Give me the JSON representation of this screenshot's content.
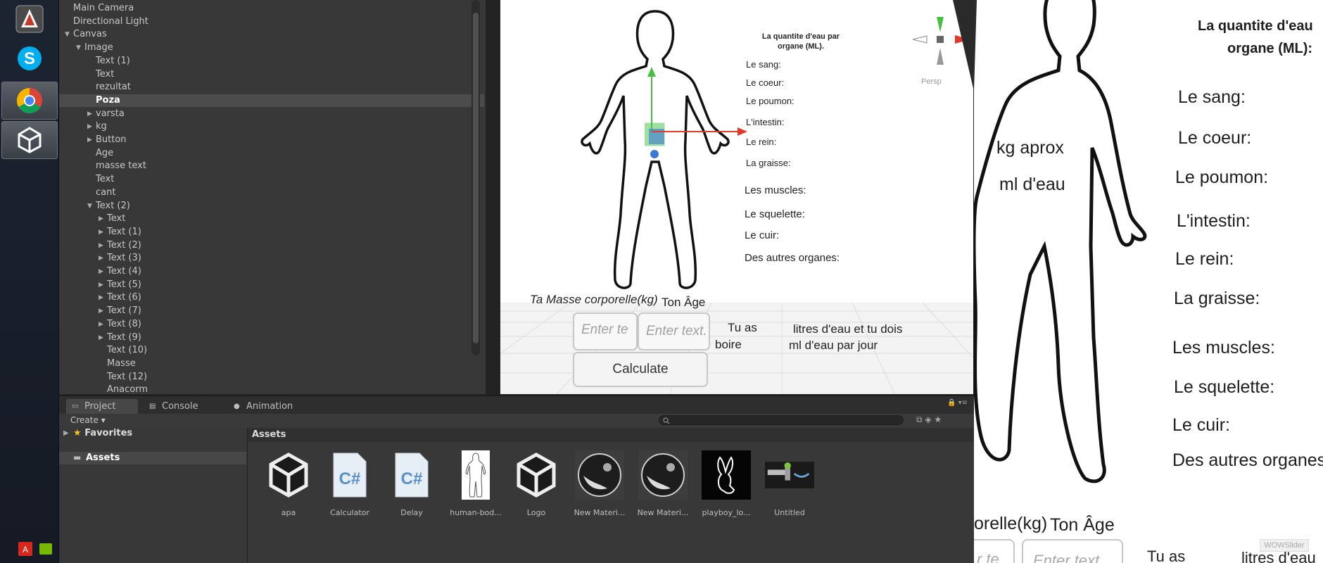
{
  "hierarchy": {
    "items": [
      {
        "label": "Main Camera",
        "indent": 0,
        "arrow": ""
      },
      {
        "label": "Directional Light",
        "indent": 0,
        "arrow": ""
      },
      {
        "label": "Canvas",
        "indent": 0,
        "arrow": "▼"
      },
      {
        "label": "Image",
        "indent": 1,
        "arrow": "▼"
      },
      {
        "label": "Text (1)",
        "indent": 2,
        "arrow": ""
      },
      {
        "label": "Text",
        "indent": 2,
        "arrow": ""
      },
      {
        "label": "rezultat",
        "indent": 2,
        "arrow": ""
      },
      {
        "label": "Poza",
        "indent": 2,
        "arrow": "",
        "selected": true
      },
      {
        "label": "varsta",
        "indent": 2,
        "arrow": "▶"
      },
      {
        "label": "kg",
        "indent": 2,
        "arrow": "▶"
      },
      {
        "label": "Button",
        "indent": 2,
        "arrow": "▶"
      },
      {
        "label": "Age",
        "indent": 2,
        "arrow": ""
      },
      {
        "label": "masse text",
        "indent": 2,
        "arrow": ""
      },
      {
        "label": "Text",
        "indent": 2,
        "arrow": ""
      },
      {
        "label": "cant",
        "indent": 2,
        "arrow": ""
      },
      {
        "label": "Text (2)",
        "indent": 2,
        "arrow": "▼"
      },
      {
        "label": "Text",
        "indent": 3,
        "arrow": "▶"
      },
      {
        "label": "Text (1)",
        "indent": 3,
        "arrow": "▶"
      },
      {
        "label": "Text (2)",
        "indent": 3,
        "arrow": "▶"
      },
      {
        "label": "Text (3)",
        "indent": 3,
        "arrow": "▶"
      },
      {
        "label": "Text (4)",
        "indent": 3,
        "arrow": "▶"
      },
      {
        "label": "Text (5)",
        "indent": 3,
        "arrow": "▶"
      },
      {
        "label": "Text (6)",
        "indent": 3,
        "arrow": "▶"
      },
      {
        "label": "Text (7)",
        "indent": 3,
        "arrow": "▶"
      },
      {
        "label": "Text (8)",
        "indent": 3,
        "arrow": "▶"
      },
      {
        "label": "Text (9)",
        "indent": 3,
        "arrow": "▶"
      },
      {
        "label": "Text (10)",
        "indent": 3,
        "arrow": ""
      },
      {
        "label": "Masse",
        "indent": 3,
        "arrow": ""
      },
      {
        "label": "Text (12)",
        "indent": 3,
        "arrow": ""
      },
      {
        "label": "Anacorm",
        "indent": 3,
        "arrow": ""
      }
    ]
  },
  "scene": {
    "title_line1": "La quantite d'eau par",
    "title_line2": "organe (ML).",
    "organs": [
      "Le sang:",
      "Le coeur:",
      "Le poumon:",
      "L'intestin:",
      "Le rein:",
      "La graisse:",
      "Les muscles:",
      "Le squelette:",
      "Le cuir:",
      "Des autres organes:"
    ],
    "mass_label": "Ta Masse corporelle(kg)",
    "age_label": "Ton Âge",
    "input1_placeholder": "Enter te",
    "input2_placeholder": "Enter text.",
    "tu_as": "Tu as",
    "boire": "boire",
    "litres_text": "litres d'eau et tu dois",
    "ml_text": "ml d'eau par jour",
    "calculate_label": "Calculate",
    "persp_label": "Persp"
  },
  "bottom": {
    "tabs": [
      "Project",
      "Console",
      "Animation"
    ],
    "create_label": "Create ▾",
    "favorites_label": "Favorites",
    "assets_label": "Assets",
    "assets_header": "Assets",
    "assets": [
      {
        "label": "apa",
        "icon": "unity-logo-icon"
      },
      {
        "label": "Calculator",
        "icon": "csharp-script-icon"
      },
      {
        "label": "Delay",
        "icon": "csharp-script-icon"
      },
      {
        "label": "human-bod...",
        "icon": "human-body-thumbnail-icon"
      },
      {
        "label": "Logo",
        "icon": "unity-logo-icon"
      },
      {
        "label": "New Materi...",
        "icon": "material-sphere-icon"
      },
      {
        "label": "New Materi...",
        "icon": "material-sphere-icon"
      },
      {
        "label": "playboy_lo...",
        "icon": "bunny-logo-icon"
      },
      {
        "label": "Untitled",
        "icon": "faucet-image-icon"
      }
    ]
  },
  "zoom": {
    "title_line1": "La quantite d'eau",
    "title_line2": "organe (ML):",
    "kg_aprox": "kg aprox",
    "ml_deau": "ml d'eau",
    "organs": [
      "Le sang:",
      "Le coeur:",
      "Le poumon:",
      "L'intestin:",
      "Le rein:",
      "La graisse:",
      "Les muscles:",
      "Le squelette:",
      "Le cuir:",
      "Des autres organes:"
    ],
    "mass_label": "orelle(kg)",
    "age_label": "Ton Âge",
    "input1": "r te",
    "input2": "Enter text",
    "tu_as": "Tu as",
    "litres": "litres d'eau",
    "watermark": "WOWSlider"
  },
  "colors": {
    "accent": "#3b78d8",
    "selection": "#4c4c4c",
    "gizmo_red": "#e23a2a",
    "gizmo_green": "#46c043"
  }
}
